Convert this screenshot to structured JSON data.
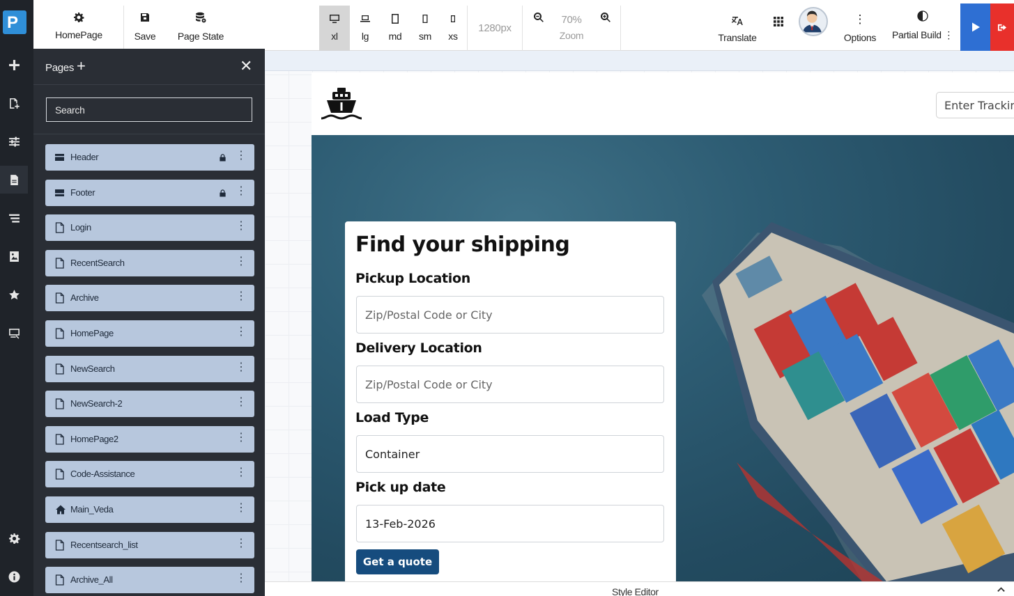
{
  "app": {
    "logo_text": "P"
  },
  "toolbar": {
    "homepage_label": "HomePage",
    "save_label": "Save",
    "page_state_label": "Page State",
    "breakpoints": [
      {
        "label": "xl",
        "active": true
      },
      {
        "label": "lg",
        "active": false
      },
      {
        "label": "md",
        "active": false
      },
      {
        "label": "sm",
        "active": false
      },
      {
        "label": "xs",
        "active": false
      }
    ],
    "width_value": "1280px",
    "zoom_value": "70%",
    "zoom_label": "Zoom",
    "translate_label": "Translate",
    "options_label": "Options",
    "partial_build_label": "Partial Build",
    "partial_build_more": "⋮"
  },
  "pages_panel": {
    "title": "Pages",
    "add_glyph": "+",
    "close_glyph": "✕",
    "search_placeholder": "Search",
    "items": [
      {
        "label": "Header",
        "icon": "header-icon",
        "locked": true
      },
      {
        "label": "Footer",
        "icon": "footer-icon",
        "locked": true
      },
      {
        "label": "Login",
        "icon": "page-icon",
        "locked": false
      },
      {
        "label": "RecentSearch",
        "icon": "page-icon",
        "locked": false
      },
      {
        "label": "Archive",
        "icon": "page-icon",
        "locked": false
      },
      {
        "label": "HomePage",
        "icon": "page-icon",
        "locked": false
      },
      {
        "label": "NewSearch",
        "icon": "page-icon",
        "locked": false
      },
      {
        "label": "NewSearch-2",
        "icon": "page-icon",
        "locked": false
      },
      {
        "label": "HomePage2",
        "icon": "page-icon",
        "locked": false
      },
      {
        "label": "Code-Assistance",
        "icon": "page-icon",
        "locked": false
      },
      {
        "label": "Main_Veda",
        "icon": "home-icon",
        "locked": false
      },
      {
        "label": "Recentsearch_list",
        "icon": "page-icon",
        "locked": false
      },
      {
        "label": "Archive_All",
        "icon": "page-icon",
        "locked": false
      }
    ],
    "item_more_glyph": "⋮"
  },
  "site": {
    "tracking_placeholder": "Enter Tracking",
    "form": {
      "title": "Find your shipping",
      "pickup_label": "Pickup Location",
      "pickup_placeholder": "Zip/Postal Code or City",
      "delivery_label": "Delivery Location",
      "delivery_placeholder": "Zip/Postal Code or City",
      "load_type_label": "Load Type",
      "load_type_value": "Container",
      "pickup_date_label": "Pick up date",
      "pickup_date_value": "13-Feb-2026",
      "quote_button": "Get a quote"
    }
  },
  "bottom_bar": {
    "label": "Style Editor"
  }
}
